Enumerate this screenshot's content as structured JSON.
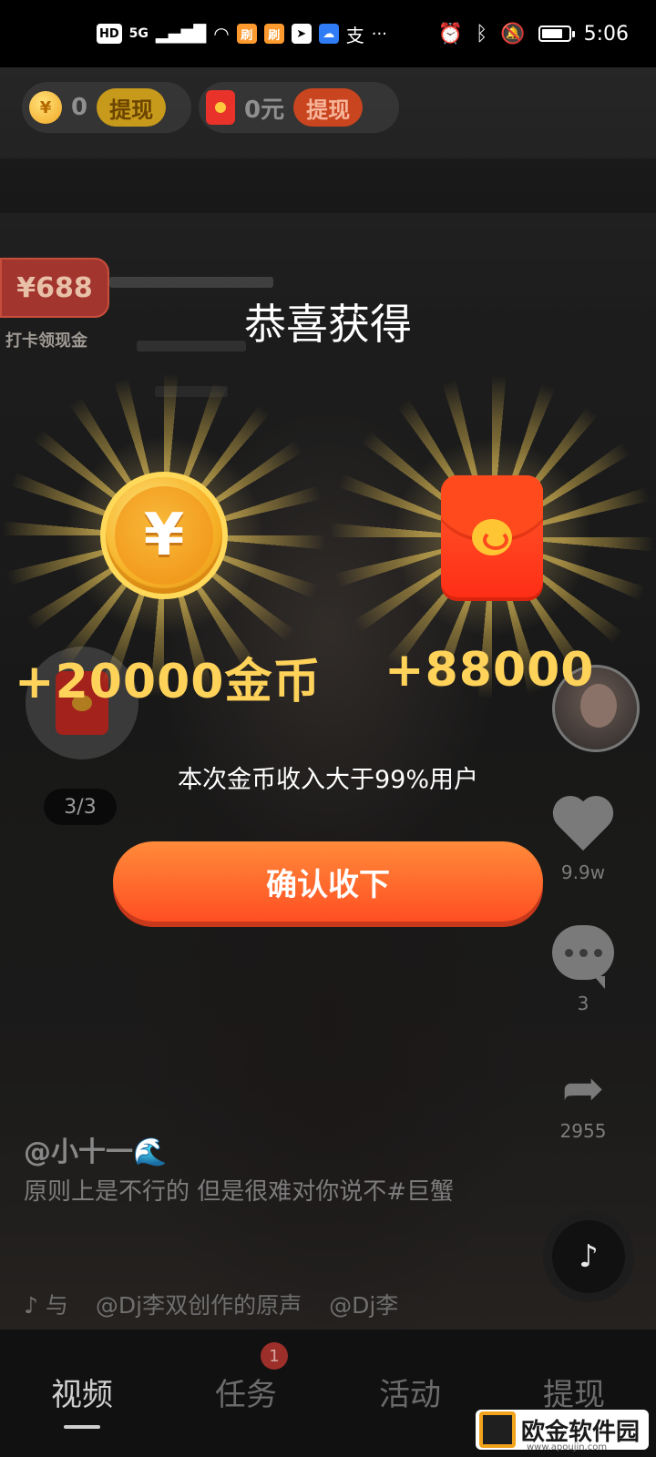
{
  "status_bar": {
    "hd": "HD",
    "network": "5G",
    "app_icons": [
      "刷",
      "刷"
    ],
    "alipay": "支",
    "more": "···",
    "time": "5:06",
    "battery_level": 0.8
  },
  "top": {
    "coins": "0",
    "coin_withdraw": "提现",
    "cash": "0元",
    "cash_withdraw": "提现"
  },
  "left": {
    "checkin_amount": "¥688",
    "checkin_label": "打卡领现金",
    "progress": "3/3"
  },
  "reward": {
    "title": "恭喜获得",
    "coin_amount": "+20000金币",
    "redpack_amount": "+88000",
    "subtitle": "本次金币收入大于99%用户",
    "confirm": "确认收下"
  },
  "right": {
    "likes": "9.9w",
    "comments": "3",
    "shares": "2955"
  },
  "caption": {
    "author": "@小十一🌊",
    "text": "原则上是不行的 但是很难对你说不#巨蟹",
    "music_prefix": "♪ 与",
    "music_title": "@Dj李双创作的原声",
    "music_more": "@Dj李"
  },
  "nav": {
    "items": [
      "视频",
      "任务",
      "活动",
      "提现"
    ],
    "badge": "1"
  },
  "watermark": {
    "text": "欧金软件园",
    "sub": "www.apoujin.com"
  },
  "colors": {
    "gold": "#ffd25a",
    "button_orange": "#ff5a24",
    "redpack": "#ff3b1e"
  }
}
